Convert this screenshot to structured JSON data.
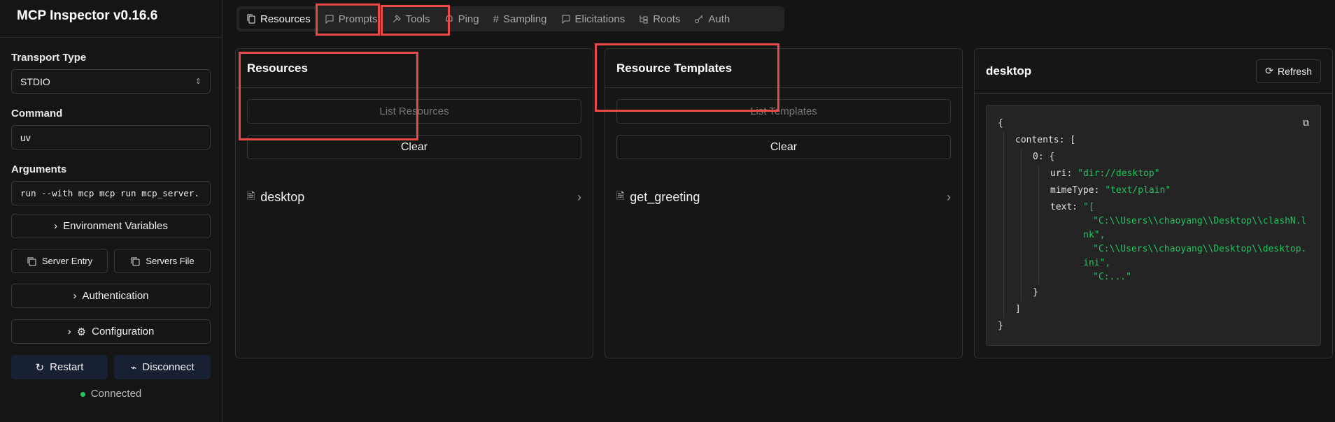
{
  "app": {
    "title": "MCP Inspector v0.16.6"
  },
  "sidebar": {
    "transport_label": "Transport Type",
    "transport_value": "STDIO",
    "command_label": "Command",
    "command_value": "uv",
    "arguments_label": "Arguments",
    "arguments_value": "run --with mcp mcp run mcp_server.",
    "env_button": "Environment Variables",
    "server_entry_button": "Server Entry",
    "servers_file_button": "Servers File",
    "auth_button": "Authentication",
    "config_button": "Configuration",
    "restart_button": "Restart",
    "disconnect_button": "Disconnect",
    "status": "Connected"
  },
  "tabs": [
    "Resources",
    "Prompts",
    "Tools",
    "Ping",
    "Sampling",
    "Elicitations",
    "Roots",
    "Auth"
  ],
  "resources_panel": {
    "title": "Resources",
    "list_button": "List Resources",
    "clear_button": "Clear",
    "items": [
      "desktop"
    ]
  },
  "templates_panel": {
    "title": "Resource Templates",
    "list_button": "List Templates",
    "clear_button": "Clear",
    "items": [
      "get_greeting"
    ]
  },
  "detail_panel": {
    "title": "desktop",
    "refresh_button": "Refresh",
    "json": {
      "open": "{",
      "contents_key": "contents:",
      "open_bracket": "[",
      "index_key": "0:",
      "index_open": "{",
      "uri_key": "uri:",
      "uri_value": "\"dir://desktop\"",
      "mime_key": "mimeType:",
      "mime_value": "\"text/plain\"",
      "text_key": "text:",
      "text_open": "\"[",
      "text_line1a": "\"C:\\\\Users\\\\chaoyang\\\\Desktop\\\\clashN.l",
      "text_line1b": "nk\",",
      "text_line2a": "\"C:\\\\Users\\\\chaoyang\\\\Desktop\\\\desktop.",
      "text_line2b": "ini\",",
      "text_line3": "\"C:...\"",
      "index_close": "}",
      "close_bracket": "]",
      "close": "}"
    }
  },
  "colors": {
    "highlight": "#e84a4a",
    "status": "#22c55e",
    "accent_dark": "#182033"
  }
}
